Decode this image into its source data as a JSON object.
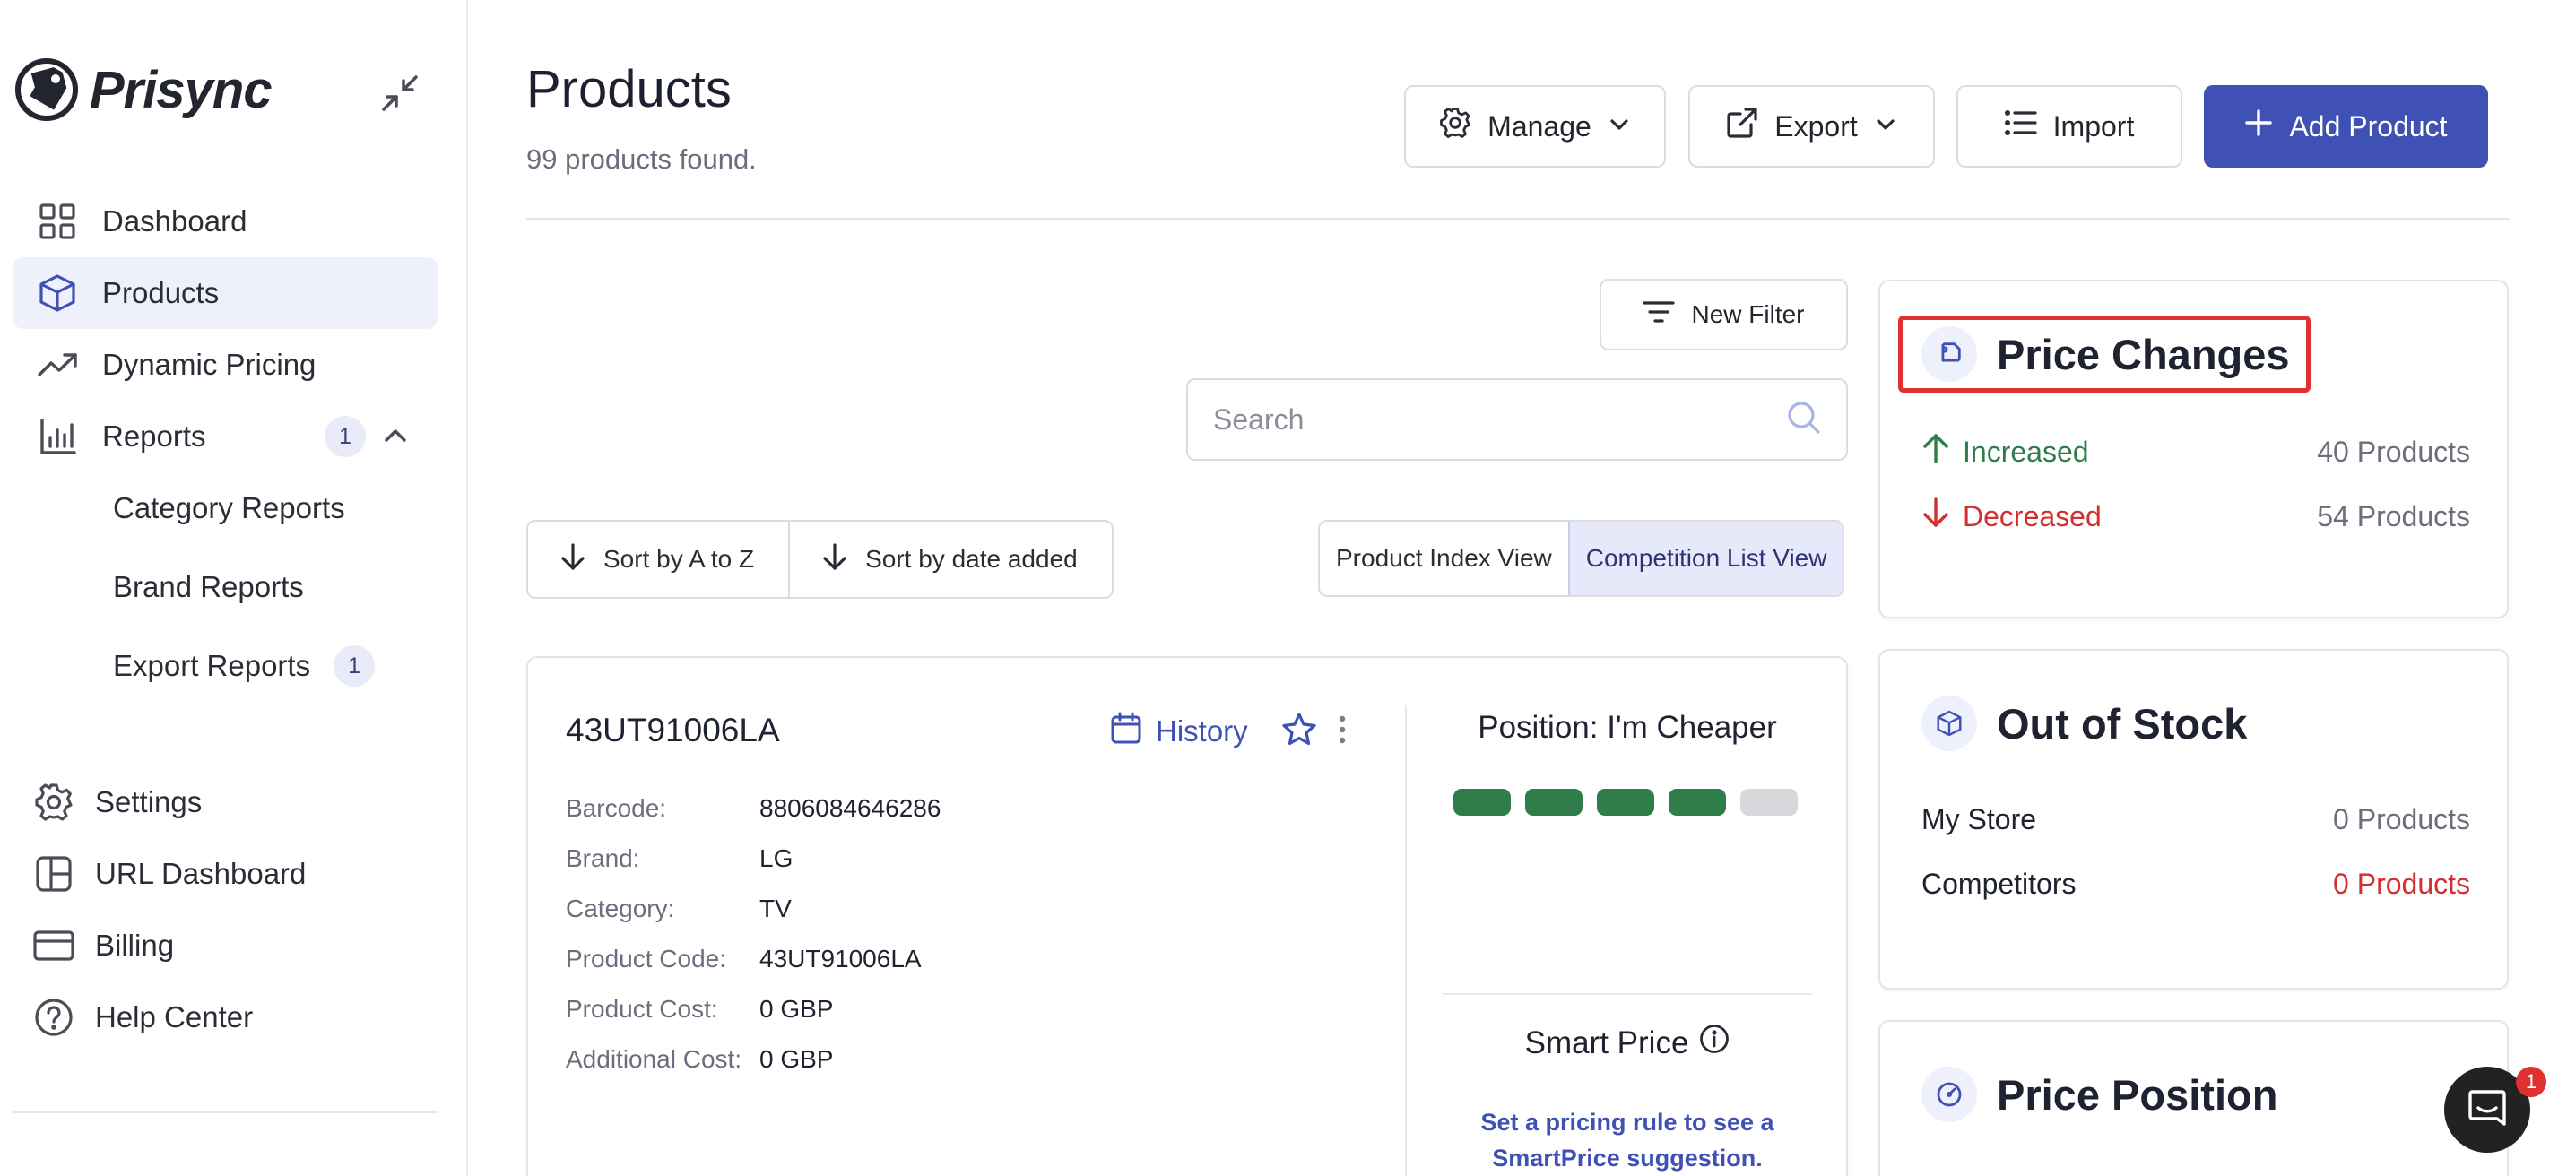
{
  "app": {
    "name": "Prisync"
  },
  "sidebar": {
    "items": [
      {
        "label": "Dashboard"
      },
      {
        "label": "Products"
      },
      {
        "label": "Dynamic Pricing"
      },
      {
        "label": "Reports",
        "badge": "1"
      }
    ],
    "report_subitems": [
      {
        "label": "Category Reports"
      },
      {
        "label": "Brand Reports"
      },
      {
        "label": "Export Reports",
        "badge": "1"
      }
    ],
    "bottom_items": [
      {
        "label": "Settings"
      },
      {
        "label": "URL Dashboard"
      },
      {
        "label": "Billing"
      },
      {
        "label": "Help Center"
      }
    ]
  },
  "header": {
    "title": "Products",
    "subtitle": "99 products found.",
    "buttons": {
      "manage": "Manage",
      "export": "Export",
      "import": "Import",
      "add": "Add Product"
    }
  },
  "filters": {
    "new_filter": "New Filter",
    "search_placeholder": "Search",
    "sort_az": "Sort by A to Z",
    "sort_date": "Sort by date added",
    "view_index": "Product Index View",
    "view_competition": "Competition List View"
  },
  "product": {
    "name": "43UT91006LA",
    "history_label": "History",
    "fields": [
      {
        "key": "Barcode:",
        "value": "8806084646286"
      },
      {
        "key": "Brand:",
        "value": "LG"
      },
      {
        "key": "Category:",
        "value": "TV"
      },
      {
        "key": "Product Code:",
        "value": "43UT91006LA"
      },
      {
        "key": "Product Cost:",
        "value": "0 GBP"
      },
      {
        "key": "Additional Cost:",
        "value": "0 GBP"
      }
    ],
    "position_label": "Position: I'm Cheaper",
    "position_level": {
      "filled": 4,
      "total": 5
    },
    "smart_price_label": "Smart Price",
    "smart_price_note": "Set a pricing rule to see a SmartPrice suggestion."
  },
  "panels": {
    "price_changes": {
      "title": "Price Changes",
      "increased_label": "Increased",
      "increased_value": "40 Products",
      "decreased_label": "Decreased",
      "decreased_value": "54 Products"
    },
    "out_of_stock": {
      "title": "Out of Stock",
      "my_store_label": "My Store",
      "my_store_value": "0 Products",
      "competitors_label": "Competitors",
      "competitors_value": "0 Products"
    },
    "price_position": {
      "title": "Price Position"
    }
  },
  "chat": {
    "badge": "1"
  },
  "colors": {
    "accent": "#3f51b5",
    "increase": "#2e7d4a",
    "decrease": "#d32f2f",
    "highlight_box": "#e03131"
  }
}
